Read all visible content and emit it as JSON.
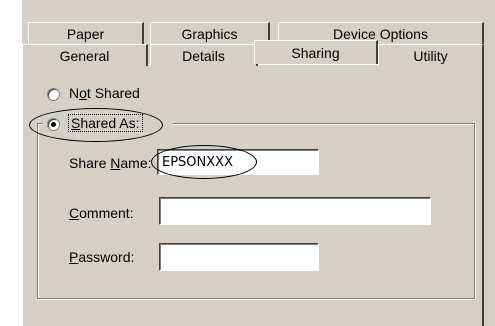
{
  "tabs": {
    "row1": [
      {
        "label": "Paper"
      },
      {
        "label": "Graphics"
      },
      {
        "label": "Device Options"
      }
    ],
    "row2": [
      {
        "label": "General"
      },
      {
        "label": "Details"
      },
      {
        "label": "Sharing",
        "active": true
      },
      {
        "label": "Utility"
      }
    ]
  },
  "sharing": {
    "not_shared": {
      "prefix": "N",
      "accel": "o",
      "suffix": "t Shared",
      "selected": false
    },
    "shared_as": {
      "accel": "S",
      "suffix": "hared As:",
      "selected": true
    },
    "share_name": {
      "prefix": "Share ",
      "accel": "N",
      "suffix": "ame:",
      "value": "EPSONXXX"
    },
    "comment": {
      "accel": "C",
      "suffix": "omment:",
      "value": ""
    },
    "password": {
      "accel": "P",
      "suffix": "assword:",
      "value": ""
    }
  }
}
